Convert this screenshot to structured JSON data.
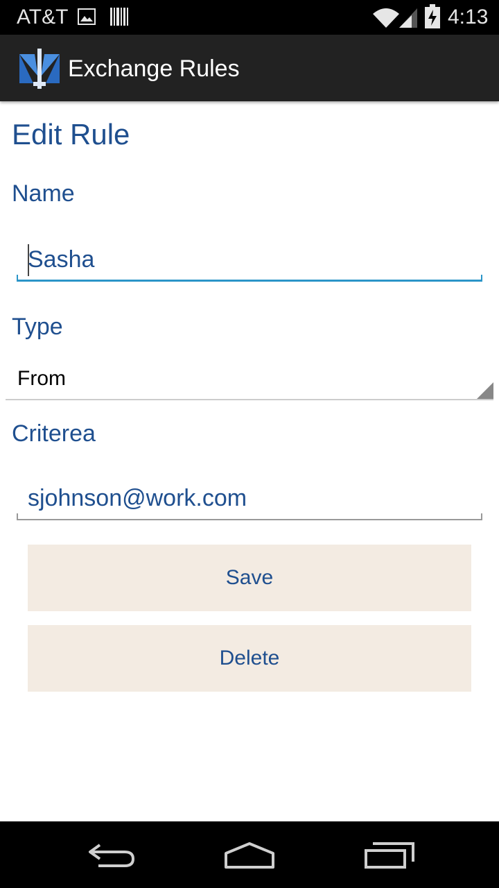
{
  "status_bar": {
    "carrier": "AT&T",
    "time": "4:13",
    "icons": [
      "photo-icon",
      "barcode-icon",
      "wifi-icon",
      "signal-icon",
      "battery-charging-icon"
    ]
  },
  "action_bar": {
    "title": "Exchange Rules",
    "logo_icon": "exchange-rules-logo"
  },
  "form": {
    "heading": "Edit Rule",
    "name_label": "Name",
    "name_value": "Sasha",
    "type_label": "Type",
    "type_value": "From",
    "criteria_label": "Criterea",
    "criteria_value": "sjohnson@work.com"
  },
  "buttons": {
    "save": "Save",
    "delete": "Delete"
  },
  "nav_bar": {
    "icons": [
      "back-icon",
      "home-icon",
      "recent-apps-icon"
    ]
  },
  "colors": {
    "accent": "#1f4f8f",
    "focus": "#2b95c8",
    "button_bg": "#f3ebe2",
    "action_bar": "#222222"
  }
}
